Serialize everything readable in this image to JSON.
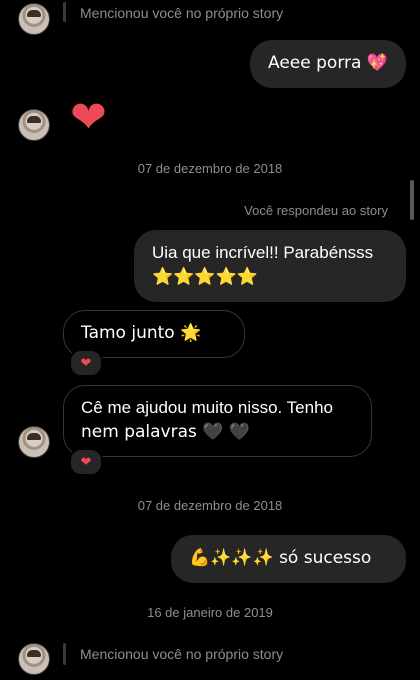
{
  "thread": {
    "mention_top": "Mencionou você no próprio story",
    "msg_out_1": "Aeee porra 💖",
    "heart_reaction": "❤",
    "date_1": "07 de dezembro de 2018",
    "reply_label": "Você respondeu ao story",
    "msg_out_2_line1": "Uia que incrível!! Parabénsss",
    "msg_out_2_line2": "⭐⭐⭐⭐⭐",
    "msg_in_1": "Tamo junto 🌟 🌟",
    "react_1": "❤",
    "msg_in_2_line1": "Cê me ajudou muito nisso. Tenho",
    "msg_in_2_line2": "nem palavras 🖤 🖤",
    "react_2": "❤",
    "date_2": "07 de dezembro de 2018",
    "msg_out_3": "💪✨✨✨ só sucesso",
    "date_3": "16 de janeiro de 2019",
    "mention_bottom": "Mencionou você no próprio story"
  },
  "colors": {
    "background": "#000000",
    "bubble_out": "#262626",
    "bubble_in_border": "#363636",
    "muted_text": "#8e8e8e",
    "heart": "#ed4956"
  }
}
